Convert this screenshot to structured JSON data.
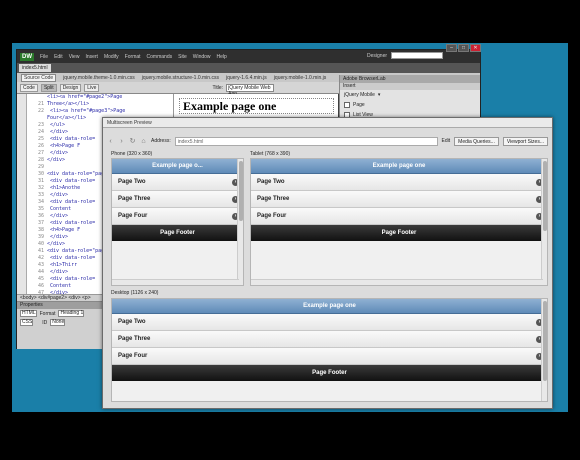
{
  "app": {
    "logo": "DW",
    "menus": [
      "File",
      "Edit",
      "View",
      "Insert",
      "Modify",
      "Format",
      "Commands",
      "Site",
      "Window",
      "Help"
    ],
    "workspace": "Designer",
    "doc_tab": "index5.html",
    "related_files": [
      "Source Code",
      "jquery.mobile.theme-1.0.min.css",
      "jquery.mobile.structure-1.0.min.css",
      "jquery-1.6.4.min.js",
      "jquery.mobile-1.0.min.js"
    ],
    "toolbar": {
      "code": "Code",
      "split": "Split",
      "design": "Design",
      "live": "Live",
      "title_label": "Title:",
      "title_value": "jQuery Mobile Web App"
    },
    "design_heading": "Example page one",
    "status_bar": "<body> <div#page2> <div> <p>",
    "properties": {
      "title": "Properties",
      "html": "HTML",
      "css": "CSS",
      "format_label": "Format",
      "format_value": "Heading 1",
      "id_label": "ID",
      "id_value": "None"
    }
  },
  "code_lines": [
    {
      "n": "",
      "t": "<li><a href=\"#page2\">Page"
    },
    {
      "n": "21",
      "t": "Three</a></li>"
    },
    {
      "n": "22",
      "t": "      <li><a href=\"#page3\">Page"
    },
    {
      "n": "",
      "t": "Four</a></li>"
    },
    {
      "n": "23",
      "t": "    </ul>"
    },
    {
      "n": "24",
      "t": "  </div>"
    },
    {
      "n": "25",
      "t": "  <div data-role="
    },
    {
      "n": "26",
      "t": "    <h4>Page F"
    },
    {
      "n": "27",
      "t": "  </div>"
    },
    {
      "n": "28",
      "t": "</div>"
    },
    {
      "n": "29",
      "t": ""
    },
    {
      "n": "30",
      "t": "<div data-role=\"pag"
    },
    {
      "n": "31",
      "t": "  <div data-role="
    },
    {
      "n": "32",
      "t": "    <h1>Anothe"
    },
    {
      "n": "33",
      "t": "  </div>"
    },
    {
      "n": "34",
      "t": "  <div data-role="
    },
    {
      "n": "35",
      "t": "    Content"
    },
    {
      "n": "36",
      "t": "  </div>"
    },
    {
      "n": "37",
      "t": "  <div data-role="
    },
    {
      "n": "38",
      "t": "    <h4>Page F"
    },
    {
      "n": "39",
      "t": "  </div>"
    },
    {
      "n": "40",
      "t": "</div>"
    },
    {
      "n": "41",
      "t": "<div data-role=\"pag"
    },
    {
      "n": "42",
      "t": "  <div data-role="
    },
    {
      "n": "43",
      "t": "    <h1>Thirr"
    },
    {
      "n": "44",
      "t": "  </div>"
    },
    {
      "n": "45",
      "t": "  <div data-role="
    },
    {
      "n": "46",
      "t": "    Content"
    },
    {
      "n": "47",
      "t": "  </div>"
    }
  ],
  "right_panel": {
    "title": "Adobe BrowserLab",
    "tab": "Insert",
    "category": "jQuery Mobile",
    "items": [
      "Page",
      "List View"
    ]
  },
  "msp": {
    "title": "Multiscreen Preview",
    "address_label": "Address:",
    "address_value": "index5.html",
    "edit": "Edit",
    "media_queries": "Media Queries...",
    "viewport_sizes": "Viewport Sizes...",
    "phone": {
      "label": "Phone (320 x 360)",
      "header": "Example page o..."
    },
    "tablet": {
      "label": "Tablet (768 x 390)",
      "header": "Example page one"
    },
    "desktop": {
      "label": "Desktop (1126 x 240)",
      "header": "Example page one"
    },
    "items": [
      "Page Two",
      "Page Three",
      "Page Four"
    ],
    "footer": "Page Footer",
    "colors": {
      "header": "#6f97c3",
      "footer": "#1b1b1b",
      "desktop_bg": "#1a7fa8"
    }
  }
}
